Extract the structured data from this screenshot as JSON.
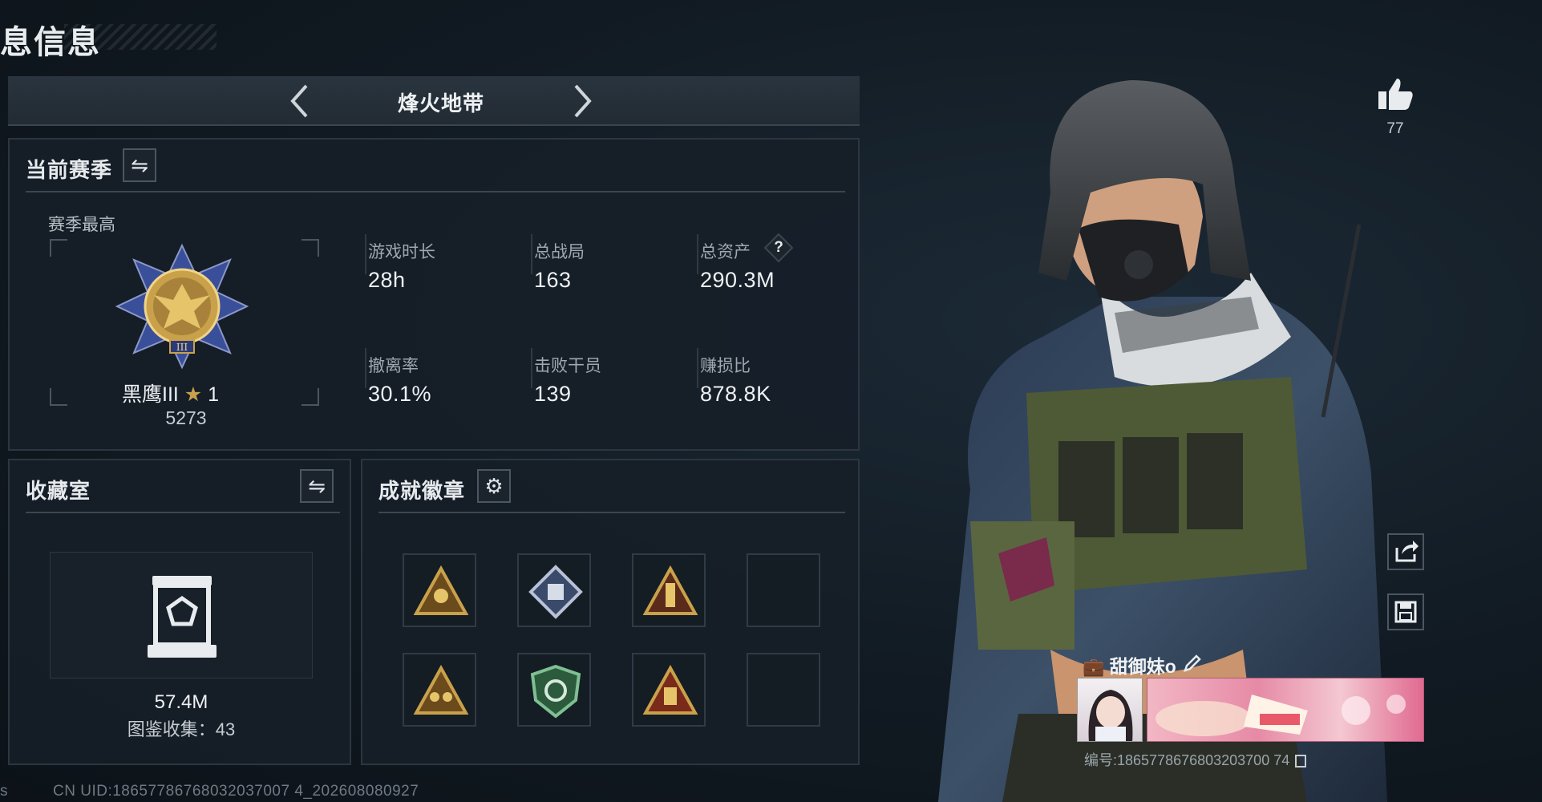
{
  "page": {
    "title": "息信息"
  },
  "mode": {
    "name": "烽火地带"
  },
  "season": {
    "title": "当前赛季",
    "best_label": "赛季最高",
    "rank_name": "黑鹰III",
    "rank_stars": "1",
    "rank_points": "5273",
    "stats": [
      {
        "label": "游戏时长",
        "value": "28h"
      },
      {
        "label": "总战局",
        "value": "163"
      },
      {
        "label": "总资产",
        "value": "290.3M",
        "help": "?"
      },
      {
        "label": "撤离率",
        "value": "30.1%"
      },
      {
        "label": "击败干员",
        "value": "139"
      },
      {
        "label": "赚损比",
        "value": "878.8K"
      }
    ]
  },
  "collection": {
    "title": "收藏室",
    "value": "57.4M",
    "catalog_text": "图鉴收集：43"
  },
  "achievements": {
    "title": "成就徽章"
  },
  "profile": {
    "likes": "77",
    "nickname": "甜御妹o",
    "id_text": "编号:1865778676803203700 74"
  },
  "footer": {
    "uid_text": "CN UID:18657786768032037007 4_202608080927",
    "left_char": "s"
  },
  "colors": {
    "gold": "#c9a14a",
    "accent_green": "#3d7a52",
    "pink": "#e68aa6"
  }
}
